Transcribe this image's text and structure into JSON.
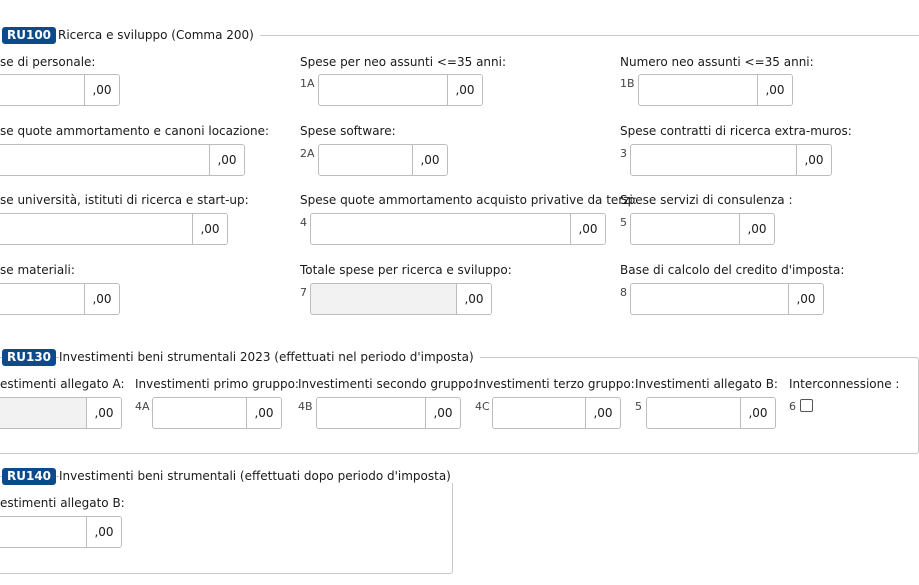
{
  "top_text": "",
  "decimal_suffix": ",00",
  "ru100": {
    "code": "RU100",
    "title": "Ricerca e sviluppo (Comma 200)",
    "fields": [
      {
        "label": "se di personale:",
        "code": ""
      },
      {
        "label": "Spese per neo assunti <=35 anni:",
        "code": "1A"
      },
      {
        "label": "Numero neo assunti <=35 anni:",
        "code": "1B"
      },
      {
        "label": "se quote ammortamento e canoni locazione:",
        "code": ""
      },
      {
        "label": "Spese software:",
        "code": "2A"
      },
      {
        "label": "Spese contratti di ricerca extra-muros:",
        "code": "3"
      },
      {
        "label": "se università, istituti di ricerca e start-up:",
        "code": ""
      },
      {
        "label": "Spese quote ammortamento acquisto privative da terzi:",
        "code": "4"
      },
      {
        "label": "Spese servizi di consulenza :",
        "code": "5"
      },
      {
        "label": "se materiali:",
        "code": ""
      },
      {
        "label": "Totale spese per ricerca e sviluppo:",
        "code": "7"
      },
      {
        "label": "Base di calcolo del credito d'imposta:",
        "code": "8"
      }
    ]
  },
  "ru130": {
    "code": "RU130",
    "title": "Investimenti beni strumentali 2023 (effettuati nel periodo d'imposta)",
    "fields": [
      {
        "label": "estimenti allegato A:",
        "code": ""
      },
      {
        "label": "Investimenti primo gruppo:",
        "code": "4A"
      },
      {
        "label": "Investimenti secondo gruppo:",
        "code": "4B"
      },
      {
        "label": "Investimenti terzo gruppo:",
        "code": "4C"
      },
      {
        "label": "Investimenti allegato B:",
        "code": "5"
      },
      {
        "label": "Interconnessione :",
        "code": "6"
      }
    ]
  },
  "ru140": {
    "code": "RU140",
    "title": "Investimenti beni strumentali (effettuati dopo periodo d'imposta)",
    "fields": [
      {
        "label": "estimenti allegato B:",
        "code": ""
      }
    ]
  }
}
